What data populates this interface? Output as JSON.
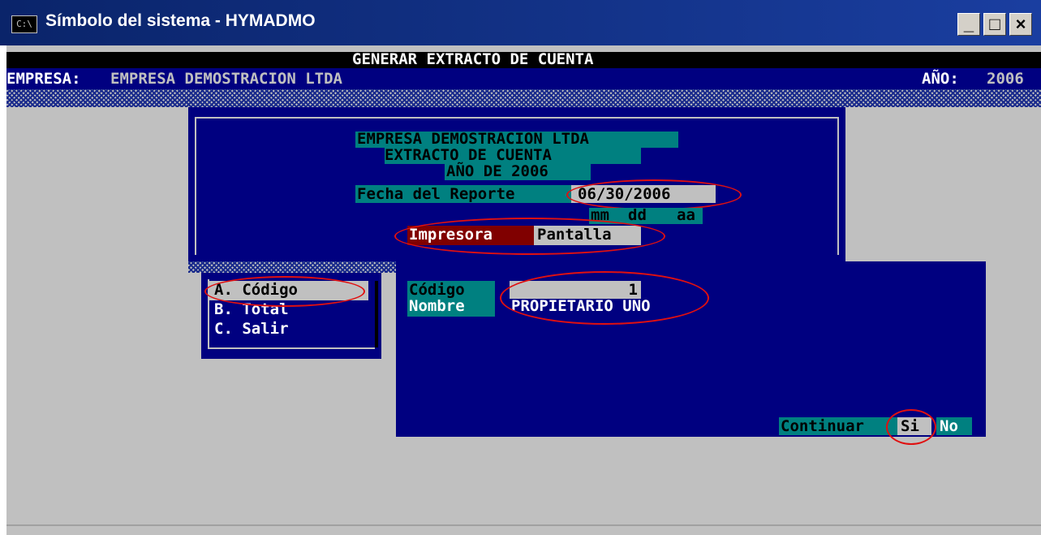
{
  "window": {
    "title": "Símbolo del sistema - HYMADMO",
    "icon_label": "C:\\"
  },
  "controls": {
    "minimize": "_",
    "maximize": "□",
    "close": "×"
  },
  "header": {
    "title": "GENERAR EXTRACTO DE CUENTA",
    "company_label": "EMPRESA:",
    "company_name": "EMPRESA DEMOSTRACION LTDA",
    "year_label": "AÑO:",
    "year_value": "2006"
  },
  "report": {
    "line1": "EMPRESA DEMOSTRACION LTDA",
    "line2": "EXTRACTO DE CUENTA",
    "line3": "AÑO DE 2006",
    "date_label": "Fecha del Reporte",
    "date_value": "06/30/2006",
    "date_hint_mm": "mm",
    "date_hint_dd": "dd",
    "date_hint_aa": "aa",
    "output_options": [
      "Impresora",
      "Pantalla"
    ]
  },
  "menu": {
    "items": [
      "A. Código",
      "B. Total",
      "C. Salir"
    ]
  },
  "detail": {
    "code_label": "Código",
    "code_value": "1",
    "name_label": "Nombre",
    "name_value": "PROPIETARIO UNO",
    "continue_label": "Continuar",
    "yes": "Si",
    "no": "No"
  },
  "colors": {
    "annotation": "#e01010",
    "panel": "#000080",
    "highlight": "#008080"
  }
}
